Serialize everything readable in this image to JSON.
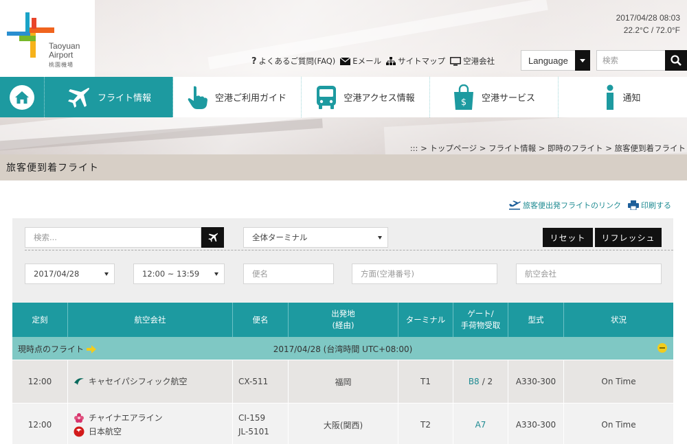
{
  "header": {
    "logo_en": "Taoyuan Airport",
    "logo_line1": "Taoyuan",
    "logo_line2": "Airport",
    "logo_cn": "桃園機場",
    "date": "2017/04/28 08:03",
    "temperature": "22.2°C / 72.0°F",
    "util_links": [
      "よくあるご質問(FAQ)",
      "Eメール",
      "サイトマップ",
      "空港会社"
    ],
    "language_label": "Language",
    "search_placeholder": "検索"
  },
  "nav": {
    "items": [
      {
        "label": "フライト情報",
        "icon": "airplane-icon",
        "active": true
      },
      {
        "label": "空港ご利用ガイド",
        "icon": "pointing-hand-icon",
        "active": false
      },
      {
        "label": "空港アクセス情報",
        "icon": "bus-icon",
        "active": false
      },
      {
        "label": "空港サービス",
        "icon": "shopping-bag-icon",
        "active": false
      },
      {
        "label": "通知",
        "icon": "info-icon",
        "active": false
      }
    ]
  },
  "breadcrumb": ":::  > トップページ > フライト情報 > 即時のフライト > 旅客便到着フライト",
  "page_title": "旅客便到着フライト",
  "top_links": {
    "departure_link": "旅客便出発フライトのリンク",
    "print": "印刷する"
  },
  "filters": {
    "search_placeholder": "検索...",
    "terminal": "全体ターミナル",
    "reset": "リセット",
    "refresh": "リフレッシュ",
    "date": "2017/04/28",
    "time": "12:00 ~ 13:59",
    "flight_placeholder": "便名",
    "origin_placeholder": "方面(空港番号)",
    "airline_placeholder": "航空会社"
  },
  "table": {
    "headers": {
      "scheduled": "定刻",
      "airline": "航空会社",
      "flight": "便名",
      "origin": "出発地",
      "origin_via": "(経由)",
      "terminal": "ターミナル",
      "gate": "ゲート/",
      "baggage": "手荷物受取",
      "aircraft": "型式",
      "status": "状況"
    },
    "group": {
      "label": "現時点のフライト",
      "date_line": "2017/04/28 (台湾時間 UTC+08:00)"
    },
    "rows": [
      {
        "time": "12:00",
        "airline1": "キャセイパシフィック航空",
        "airline2": "",
        "flight1": "CX-511",
        "flight2": "",
        "origin": "福岡",
        "terminal": "T1",
        "gate": "B8",
        "baggage": "/ 2",
        "aircraft": "A330-300",
        "status": "On Time"
      },
      {
        "time": "12:00",
        "airline1": "チャイナエアライン",
        "airline2": "日本航空",
        "flight1": "CI-159",
        "flight2": "JL-5101",
        "origin": "大阪(関西)",
        "terminal": "T2",
        "gate": "A7",
        "baggage": "",
        "aircraft": "A330-300",
        "status": "On Time"
      }
    ]
  },
  "colors": {
    "teal": "#1d9aa0",
    "group_row": "#7fc8c4",
    "title_bar": "#d7cfc6",
    "accent_yellow": "#f2cc1d"
  }
}
